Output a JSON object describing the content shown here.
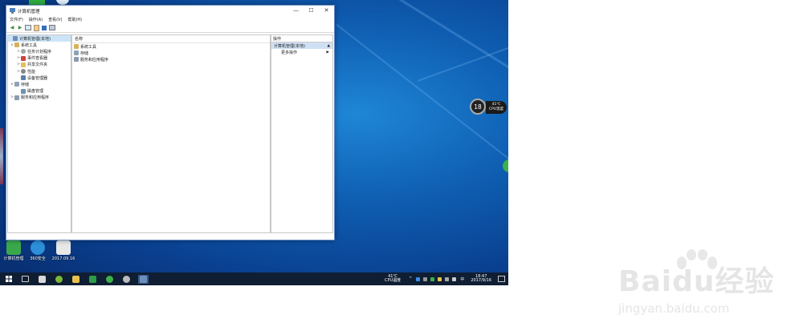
{
  "window": {
    "title": "计算机管理",
    "controls": {
      "minimize": "—",
      "maximize": "☐",
      "close": "✕"
    },
    "menus": [
      "文件(F)",
      "操作(A)",
      "查看(V)",
      "帮助(H)"
    ]
  },
  "tree": {
    "root": "计算机管理(本地)",
    "system_tools": "系统工具",
    "task_scheduler": "任务计划程序",
    "event_viewer": "事件查看器",
    "shared_folders": "共享文件夹",
    "performance": "性能",
    "device_manager": "设备管理器",
    "storage": "存储",
    "disk_management": "磁盘管理",
    "services_apps": "服务和应用程序"
  },
  "list": {
    "header": "名称",
    "items": [
      "系统工具",
      "存储",
      "服务和应用程序"
    ]
  },
  "actions": {
    "header": "操作",
    "section": "计算机管理(本地)",
    "more": "更多操作"
  },
  "taskbar": {
    "temp_value": "41℃",
    "temp_label": "CPU温度",
    "ime": "中",
    "time": "18:47",
    "date": "2017/9/16"
  },
  "gadget": {
    "number": "18",
    "temp": "41℃",
    "label": "CPU温度"
  },
  "desktop_icons": [
    {
      "label": "计算机管理",
      "color": "#3aa84a"
    },
    {
      "label": "360安全",
      "color": "#2d8fd8"
    },
    {
      "label": "2017.09.16",
      "color": "#e8e8e8"
    }
  ],
  "watermark": {
    "brand": "Baidu经验",
    "url": "jingyan.baidu.com"
  },
  "colors": {
    "desktop": "#0f5fb3",
    "selection": "#cce4f7",
    "taskbar": "#0f1e33"
  }
}
